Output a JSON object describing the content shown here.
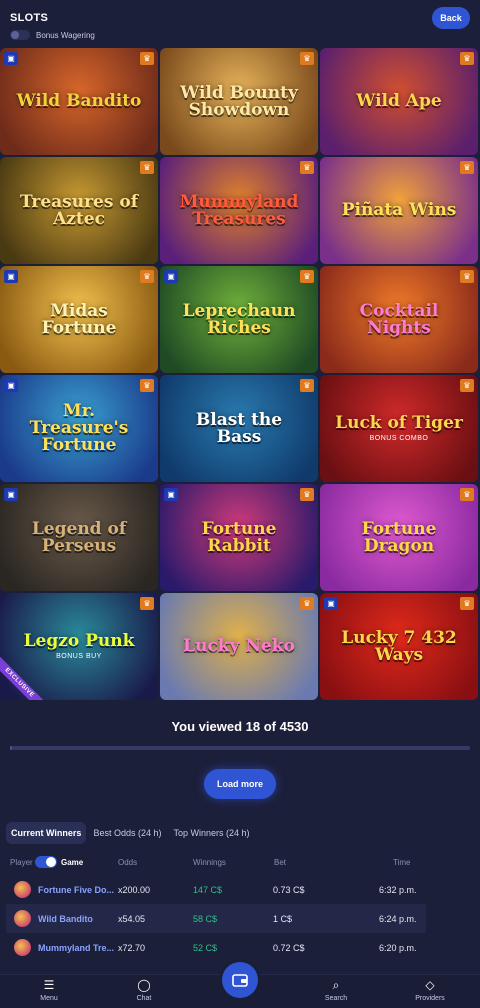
{
  "header": {
    "title": "SLOTS",
    "bonus_label": "Bonus Wagering",
    "back_label": "Back"
  },
  "games": [
    {
      "name": "Wild Bandito",
      "badge": "gift",
      "trophy": true,
      "bg": "#6e2b1a",
      "bg2": "#d7662a",
      "fg": "#f3d33c"
    },
    {
      "name": "Wild Bounty Showdown",
      "badge": "",
      "trophy": true,
      "bg": "#7a4a1c",
      "bg2": "#e6b35a",
      "fg": "#ffe8a3"
    },
    {
      "name": "Wild Ape",
      "badge": "",
      "trophy": true,
      "bg": "#5a1f6d",
      "bg2": "#d14f2f",
      "fg": "#ffd54a"
    },
    {
      "name": "Treasures of Aztec",
      "badge": "",
      "trophy": true,
      "bg": "#4a3a12",
      "bg2": "#c89a33",
      "fg": "#ffe08a"
    },
    {
      "name": "Mummyland Treasures",
      "badge": "",
      "trophy": true,
      "bg": "#5a1f7a",
      "bg2": "#e0812a",
      "fg": "#ff5a3c"
    },
    {
      "name": "Piñata Wins",
      "badge": "",
      "trophy": true,
      "bg": "#7a2f8a",
      "bg2": "#f0a23a",
      "fg": "#ffe05a"
    },
    {
      "name": "Midas Fortune",
      "badge": "gift",
      "trophy": true,
      "bg": "#8a5a12",
      "bg2": "#f2c14e",
      "fg": "#fff1b0"
    },
    {
      "name": "Leprechaun Riches",
      "badge": "gift",
      "trophy": true,
      "bg": "#1f4a24",
      "bg2": "#6fb13a",
      "fg": "#ffe05a"
    },
    {
      "name": "Cocktail Nights",
      "badge": "",
      "trophy": true,
      "bg": "#8a2a1a",
      "bg2": "#f07a2a",
      "fg": "#ff7ad0"
    },
    {
      "name": "Mr. Treasure's Fortune",
      "badge": "gift",
      "trophy": true,
      "bg": "#1a3a8a",
      "bg2": "#3aa0d0",
      "fg": "#ffe05a"
    },
    {
      "name": "Blast the Bass",
      "badge": "",
      "trophy": true,
      "bg": "#0f3a6a",
      "bg2": "#2a7ab0",
      "fg": "#ffffff"
    },
    {
      "name": "Luck of Tiger",
      "sub": "BONUS COMBO",
      "badge": "",
      "trophy": true,
      "bg": "#6a0f12",
      "bg2": "#d02a2a",
      "fg": "#ffd54a"
    },
    {
      "name": "Legend of Perseus",
      "badge": "gift",
      "trophy": false,
      "bg": "#2a2622",
      "bg2": "#6a5a4a",
      "fg": "#d6b27a"
    },
    {
      "name": "Fortune Rabbit",
      "badge": "gift",
      "trophy": true,
      "bg": "#2a1a6a",
      "bg2": "#d03a7a",
      "fg": "#ffd54a"
    },
    {
      "name": "Fortune Dragon",
      "badge": "",
      "trophy": true,
      "bg": "#8a2aa0",
      "bg2": "#e05ad0",
      "fg": "#ffd54a"
    },
    {
      "name": "Legzo Punk",
      "sub": "BONUS BUY",
      "badge": "",
      "trophy": true,
      "exclusive": "EXCLUSIVE",
      "bg": "#1a1a4a",
      "bg2": "#2a8a9a",
      "fg": "#e8ff3a"
    },
    {
      "name": "Lucky Neko",
      "badge": "",
      "trophy": true,
      "bg": "#6a7ab0",
      "bg2": "#e0b04a",
      "fg": "#ff7ad0"
    },
    {
      "name": "Lucky 7 432 Ways",
      "badge": "gift",
      "trophy": true,
      "bg": "#8a0f12",
      "bg2": "#e02a1a",
      "fg": "#ffd54a"
    }
  ],
  "viewed_text": "You viewed 18 of 4530",
  "progress_fraction": 0.004,
  "load_more_label": "Load more",
  "winners": {
    "tabs": [
      "Current Winners",
      "Best Odds (24 h)",
      "Top Winners (24 h)"
    ],
    "columns": {
      "player": "Player",
      "game": "Game",
      "odds": "Odds",
      "winnings": "Winnings",
      "bet": "Bet",
      "time": "Time"
    },
    "rows": [
      {
        "game": "Fortune Five Do...",
        "odds": "x200.00",
        "winnings": "147 C$",
        "bet": "0.73 C$",
        "time": "6:32 p.m."
      },
      {
        "game": "Wild Bandito",
        "odds": "x54.05",
        "winnings": "58 C$",
        "bet": "1 C$",
        "time": "6:24 p.m."
      },
      {
        "game": "Mummyland Tre...",
        "odds": "x72.70",
        "winnings": "52 C$",
        "bet": "0.72 C$",
        "time": "6:20 p.m."
      }
    ]
  },
  "nav": {
    "menu": "Menu",
    "chat": "Chat",
    "search": "Search",
    "providers": "Providers"
  },
  "colors": {
    "background": "#1c1f3a",
    "accent": "#2f55d4",
    "winnings_green": "#2fbf86",
    "trophy_orange": "#e07a1f",
    "gift_blue": "#1d39b3"
  }
}
